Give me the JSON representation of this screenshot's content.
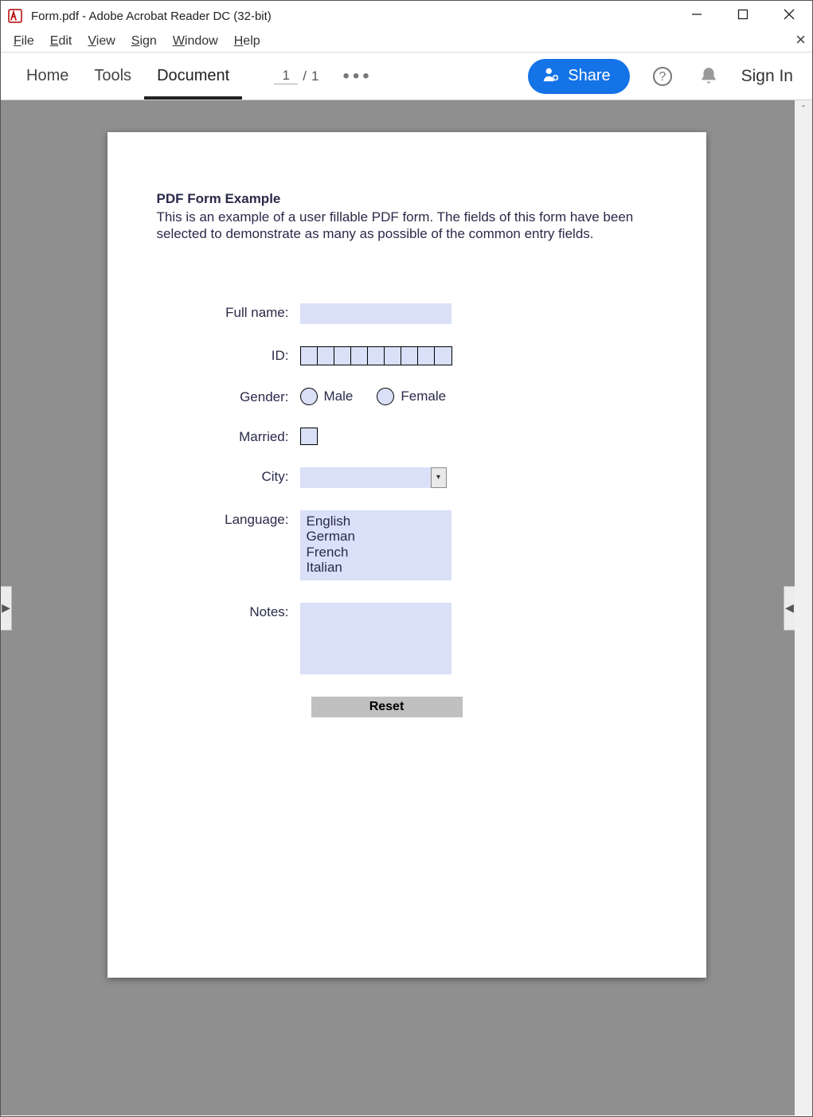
{
  "window": {
    "title": "Form.pdf - Adobe Acrobat Reader DC (32-bit)"
  },
  "menu": {
    "file": "File",
    "edit": "Edit",
    "view": "View",
    "sign": "Sign",
    "window": "Window",
    "help": "Help"
  },
  "toolbar": {
    "home": "Home",
    "tools": "Tools",
    "document": "Document",
    "page_current": "1",
    "page_sep": "/",
    "page_total": "1",
    "share": "Share",
    "signin": "Sign In"
  },
  "form": {
    "title": "PDF Form Example",
    "desc": "This is an example of a user fillable PDF form. The fields of this form have been selected to demonstrate as many as possible of the common entry fields.",
    "labels": {
      "fullname": "Full name:",
      "id": "ID:",
      "gender": "Gender:",
      "married": "Married:",
      "city": "City:",
      "language": "Language:",
      "notes": "Notes:"
    },
    "gender_options": {
      "male": "Male",
      "female": "Female"
    },
    "language_options": [
      "English",
      "German",
      "French",
      "Italian"
    ],
    "reset": "Reset"
  }
}
